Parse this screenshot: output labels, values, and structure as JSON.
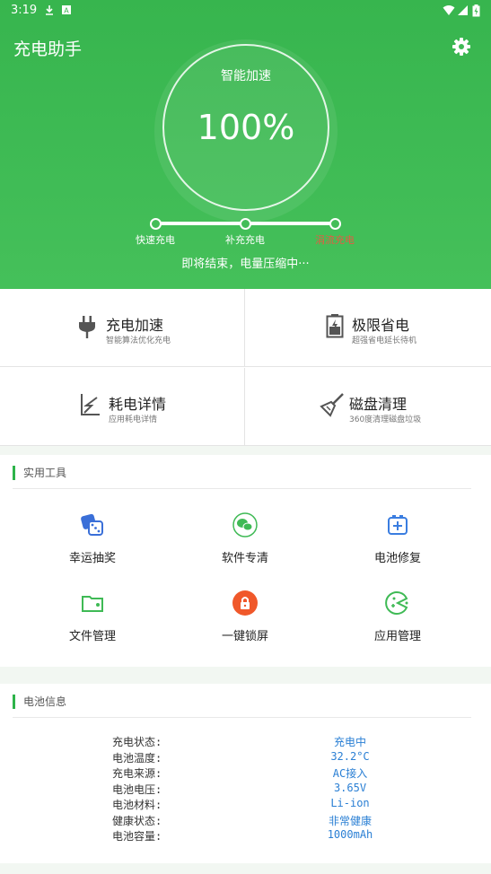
{
  "status_bar": {
    "time": "3:19"
  },
  "header": {
    "title": "充电助手",
    "ring_label": "智能加速",
    "ring_value": "100%",
    "steps": [
      "快速充电",
      "补充充电",
      "涓流充电"
    ],
    "note": "即将结束，电量压缩中···"
  },
  "features": [
    {
      "title": "充电加速",
      "subtitle": "智能算法优化充电",
      "icon": "plug-icon"
    },
    {
      "title": "极限省电",
      "subtitle": "超强省电延长待机",
      "icon": "battery-icon"
    },
    {
      "title": "耗电详情",
      "subtitle": "应用耗电详情",
      "icon": "bolt-chart-icon"
    },
    {
      "title": "磁盘清理",
      "subtitle": "360度清理磁盘垃圾",
      "icon": "broom-icon"
    }
  ],
  "tools": {
    "title": "实用工具",
    "items": [
      {
        "label": "幸运抽奖",
        "icon": "dice-icon"
      },
      {
        "label": "软件专清",
        "icon": "wechat-icon"
      },
      {
        "label": "电池修复",
        "icon": "battery-plus-icon"
      },
      {
        "label": "文件管理",
        "icon": "folder-icon"
      },
      {
        "label": "一键锁屏",
        "icon": "lock-icon"
      },
      {
        "label": "应用管理",
        "icon": "pacman-icon"
      }
    ]
  },
  "battery_info": {
    "title": "电池信息",
    "rows": [
      {
        "key": "充电状态:",
        "value": "充电中"
      },
      {
        "key": "电池温度:",
        "value": "32.2°C"
      },
      {
        "key": "充电来源:",
        "value": "AC接入"
      },
      {
        "key": "电池电压:",
        "value": "3.65V"
      },
      {
        "key": "电池材料:",
        "value": "Li-ion"
      },
      {
        "key": "健康状态:",
        "value": "非常健康"
      },
      {
        "key": "电池容量:",
        "value": "1000mAh"
      }
    ]
  },
  "colors": {
    "primary_green": "#3fba55",
    "accent_blue": "#2a7fd4",
    "active_step": "#e65a43",
    "lock_orange": "#f0582a"
  }
}
